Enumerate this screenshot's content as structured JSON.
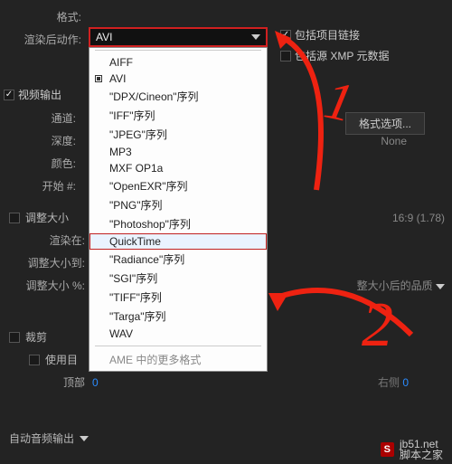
{
  "labels": {
    "format": "格式:",
    "postRender": "渲染后动作:",
    "channels": "通道:",
    "depth": "深度:",
    "color": "颜色:",
    "start": "开始 #:",
    "resize": "调整大小",
    "resizeAt": "渲染在:",
    "resizeTo": "调整大小到:",
    "resizePct": "调整大小 %:",
    "crop": "裁剪",
    "useTarget": "使用目",
    "top": "顶部",
    "right": "右侧"
  },
  "dropdown": {
    "current": "AVI",
    "items": [
      {
        "label": "AIFF",
        "checked": false
      },
      {
        "label": "AVI",
        "checked": true
      },
      {
        "label": "\"DPX/Cineon\"序列",
        "checked": false
      },
      {
        "label": "\"IFF\"序列",
        "checked": false
      },
      {
        "label": "\"JPEG\"序列",
        "checked": false
      },
      {
        "label": "MP3",
        "checked": false
      },
      {
        "label": "MXF OP1a",
        "checked": false
      },
      {
        "label": "\"OpenEXR\"序列",
        "checked": false
      },
      {
        "label": "\"PNG\"序列",
        "checked": false
      },
      {
        "label": "\"Photoshop\"序列",
        "checked": false
      },
      {
        "label": "QuickTime",
        "checked": false,
        "highlight": true
      },
      {
        "label": "\"Radiance\"序列",
        "checked": false
      },
      {
        "label": "\"SGI\"序列",
        "checked": false
      },
      {
        "label": "\"TIFF\"序列",
        "checked": false
      },
      {
        "label": "\"Targa\"序列",
        "checked": false
      },
      {
        "label": "WAV",
        "checked": false
      }
    ],
    "more": "AME 中的更多格式"
  },
  "checks": {
    "includeProjectLinks": "包括项目链接",
    "includeSourceXMP": "包括源 XMP 元数据",
    "videoOutput": "视频输出"
  },
  "buttons": {
    "formatOptions": "格式选项...",
    "resizeQuality": "整大小后的品质"
  },
  "values": {
    "depthNone": "None",
    "aspect": "16:9 (1.78)",
    "top": "0",
    "right": "0"
  },
  "footer": {
    "audioOutput": "自动音频输出"
  },
  "annotations": {
    "one": "1",
    "two": "2"
  },
  "watermark": {
    "badge": "S",
    "site": "jb51.net",
    "name": "脚本之家"
  }
}
